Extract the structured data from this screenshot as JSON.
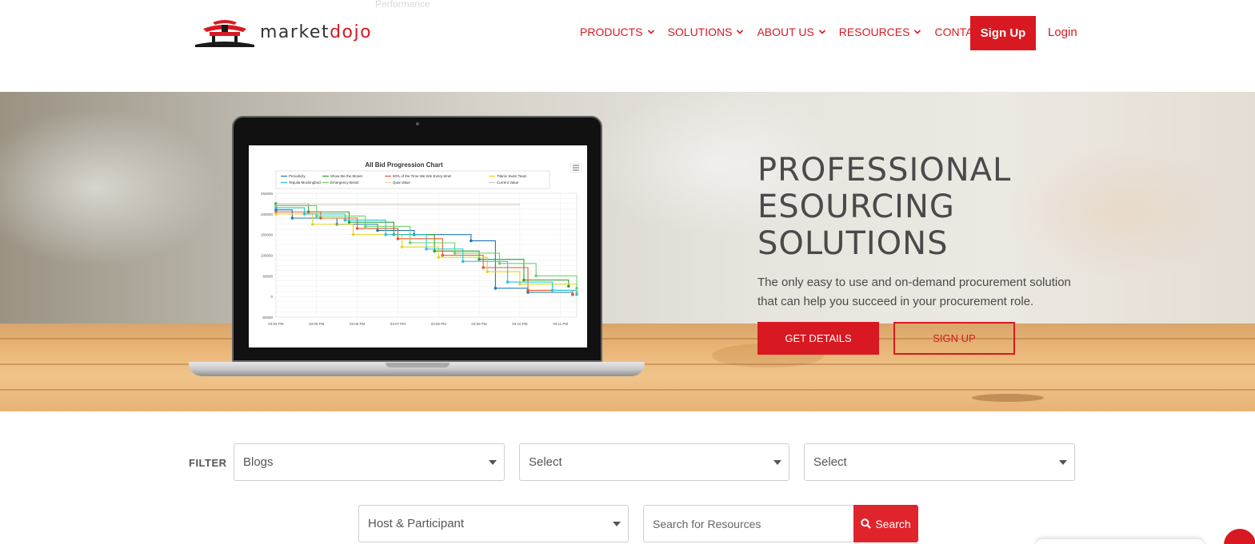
{
  "header": {
    "ghost_label": "Performance",
    "logo": {
      "text_a": "market",
      "text_b": "dojo"
    },
    "nav": [
      {
        "label": "PRODUCTS",
        "has_dropdown": true
      },
      {
        "label": "SOLUTIONS",
        "has_dropdown": true
      },
      {
        "label": "ABOUT US",
        "has_dropdown": true
      },
      {
        "label": "RESOURCES",
        "has_dropdown": true
      },
      {
        "label": "CONTACT",
        "has_dropdown": false
      }
    ],
    "signup": "Sign Up",
    "login": "Login"
  },
  "hero": {
    "title_lines": [
      "PROFESSIONAL",
      "ESOURCING",
      "SOLUTIONS"
    ],
    "subtitle": "The only easy to use and on-demand procurement solution that can help you succeed in your procurement role.",
    "btn_details": "GET DETAILS",
    "btn_signup": "SIGN UP"
  },
  "chart_data": {
    "type": "line",
    "title": "All Bid Progression Chart",
    "legend": [
      "Periodicity",
      "Show Me the Monet",
      "60% of the Time We Win Every-time!",
      "Titanic Swim Team",
      "Tequila Mockingbird",
      "Emergency Brexit",
      "Qual Value",
      "Current Value"
    ],
    "colors": [
      "#1f77b4",
      "#2ca02c",
      "#e45a2a",
      "#e6d31e",
      "#29c2d8",
      "#6ad36a",
      "#f3d7a8",
      "#cccccc"
    ],
    "y_ticks": [
      "250000",
      "200000",
      "150000",
      "100000",
      "50000",
      "0",
      "-50000"
    ],
    "x_ticks": [
      "03:04 PM",
      "03:05 PM",
      "03:06 PM",
      "03:07 PM",
      "03:08 PM",
      "03:09 PM",
      "03:10 PM",
      "03:11 PM"
    ],
    "ylim": [
      -50000,
      250000
    ],
    "series": [
      {
        "name": "Periodicity",
        "x": [
          0,
          0.4,
          1.5,
          2.5,
          3.4,
          4.8,
          5.4,
          6.2,
          7.3
        ],
        "y": [
          210000,
          190000,
          175000,
          160000,
          150000,
          135000,
          20000,
          10000,
          5000
        ]
      },
      {
        "name": "Show Me the Monet",
        "x": [
          0,
          0.8,
          1.8,
          2.9,
          3.9,
          5.0,
          6.1,
          7.2
        ],
        "y": [
          225000,
          205000,
          180000,
          150000,
          110000,
          90000,
          40000,
          25000
        ]
      },
      {
        "name": "60% of the Time We Win Every-time!",
        "x": [
          0,
          1.1,
          2.0,
          3.0,
          4.1,
          5.1,
          6.2,
          7.3
        ],
        "y": [
          205000,
          190000,
          165000,
          140000,
          100000,
          70000,
          15000,
          5000
        ]
      },
      {
        "name": "Titanic Swim Team",
        "x": [
          0,
          0.9,
          1.9,
          3.1,
          4.0,
          5.2,
          6.0,
          7.4
        ],
        "y": [
          200000,
          175000,
          150000,
          120000,
          95000,
          60000,
          30000,
          10000
        ]
      },
      {
        "name": "Tequila Mockingbird",
        "x": [
          0,
          0.7,
          1.7,
          2.7,
          3.7,
          4.6,
          5.7,
          6.8,
          7.4
        ],
        "y": [
          215000,
          200000,
          185000,
          150000,
          115000,
          85000,
          35000,
          15000,
          5000
        ]
      },
      {
        "name": "Emergency Brexit",
        "x": [
          0,
          1.0,
          2.2,
          3.3,
          4.4,
          5.5,
          6.4,
          7.4
        ],
        "y": [
          220000,
          195000,
          170000,
          130000,
          105000,
          80000,
          50000,
          20000
        ]
      },
      {
        "name": "Qual Value",
        "x": [
          0,
          6.0
        ],
        "y": [
          225000,
          225000
        ]
      },
      {
        "name": "Current Value",
        "x": [
          0,
          6.0
        ],
        "y": [
          222000,
          222000
        ]
      }
    ]
  },
  "filter": {
    "label": "FILTER",
    "selects": [
      "Blogs",
      "Select",
      "Select",
      "Host & Participant"
    ],
    "search_placeholder": "Search for Resources",
    "search_button": "Search"
  }
}
